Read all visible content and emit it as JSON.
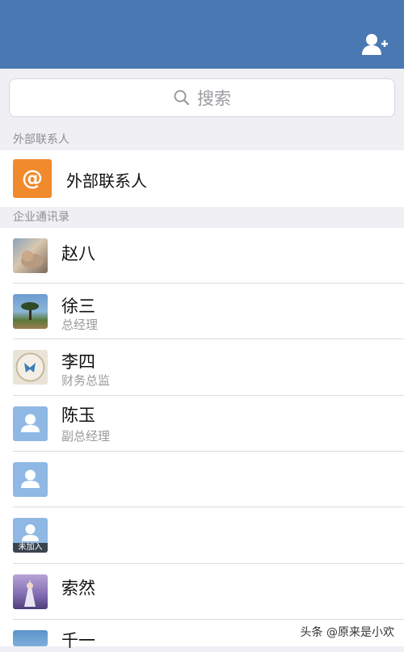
{
  "search": {
    "placeholder": "搜索"
  },
  "sections": {
    "external": "外部联系人",
    "directory": "企业通讯录"
  },
  "external_item": {
    "label": "外部联系人",
    "icon": "at-icon"
  },
  "contacts": [
    {
      "name": "赵八",
      "title": ""
    },
    {
      "name": "徐三",
      "title": "总经理"
    },
    {
      "name": "李四",
      "title": "财务总监"
    },
    {
      "name": "陈玉",
      "title": "副总经理"
    },
    {
      "name": "",
      "title": ""
    },
    {
      "name": "",
      "title": "",
      "badge": "未加入"
    },
    {
      "name": "索然",
      "title": ""
    },
    {
      "name": "千一",
      "title": ""
    }
  ],
  "watermark": "头条 @原来是小欢",
  "colors": {
    "header": "#4a78b2",
    "external_icon": "#f08a2c",
    "placeholder_avatar": "#8fb8e4"
  }
}
